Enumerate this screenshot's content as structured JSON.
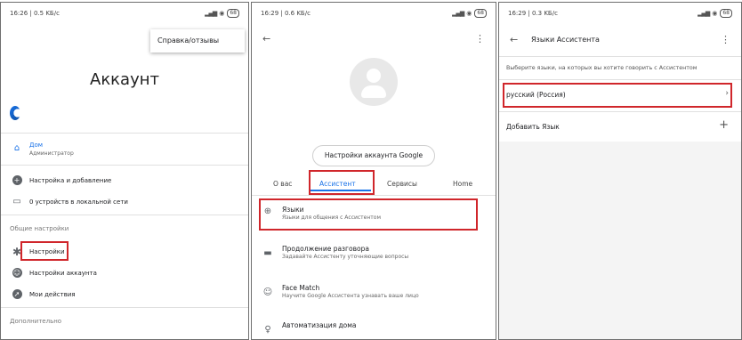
{
  "panel1": {
    "status_time": "16:26 | 0.5 KБ/с",
    "battery": "68",
    "menu_item": "Справка/отзывы",
    "title": "Аккаунт",
    "home_label": "Дом",
    "home_sub": "Администратор",
    "setup_label": "Настройка и добавление",
    "devices_label": "0 устройств в локальной сети",
    "section_general": "Общие настройки",
    "settings_label": "Настройки",
    "account_settings_label": "Настройки аккаунта",
    "activity_label": "Мои действия",
    "section_more": "Дополнительно"
  },
  "panel2": {
    "status_time": "16:29 | 0.6 KБ/с",
    "battery": "68",
    "manage_button": "Настройки аккаунта Google",
    "tabs": [
      "О вас",
      "Ассистент",
      "Сервисы",
      "Home"
    ],
    "rows": [
      {
        "label": "Языки",
        "sub": "Языки для общения с Ассистентом"
      },
      {
        "label": "Продолжение разговора",
        "sub": "Задавайте Ассистенту уточняющие вопросы"
      },
      {
        "label": "Face Match",
        "sub": "Научите Google Ассистента узнавать ваше лицо"
      },
      {
        "label": "Автоматизация дома",
        "sub": ""
      }
    ]
  },
  "panel3": {
    "status_time": "16:29 | 0.3 KБ/с",
    "battery": "68",
    "title": "Языки Ассистента",
    "description": "Выберите языки, на которых вы хотите говорить с Ассистентом",
    "language": "русский (Россия)",
    "add_language": "Добавить Язык"
  },
  "colors": {
    "accent": "#1a73e8",
    "highlight": "#d0262b"
  }
}
